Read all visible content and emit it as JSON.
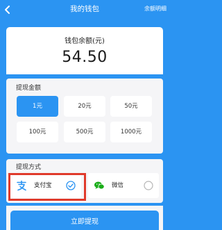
{
  "header": {
    "title": "我的钱包",
    "link_label": "余额明细"
  },
  "balance": {
    "label": "钱包余额(元)",
    "amount": "54.50"
  },
  "amount_section": {
    "title": "提现金额",
    "options": [
      "1元",
      "20元",
      "50元",
      "100元",
      "500元",
      "1000元"
    ],
    "selected": "1元"
  },
  "method_section": {
    "title": "提现方式",
    "options": [
      {
        "label": "支付宝",
        "icon": "alipay-icon",
        "selected": true
      },
      {
        "label": "微信",
        "icon": "wechat-icon",
        "selected": false
      }
    ]
  },
  "submit_label": "立即提现",
  "colors": {
    "accent": "#2b94f2",
    "highlight": "#e03a2b",
    "wechat": "#1aad19"
  }
}
